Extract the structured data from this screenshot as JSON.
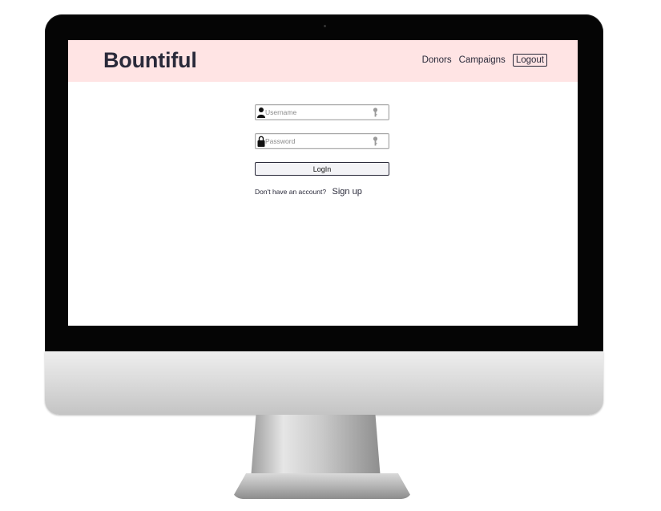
{
  "navbar": {
    "brand": "Bountiful",
    "links": [
      "Donors",
      "Campaigns"
    ],
    "logout_label": "Logout"
  },
  "login": {
    "username_placeholder": "Username",
    "password_placeholder": "Password",
    "button_label": "LogIn",
    "signup_prompt": "Don't have an account?",
    "signup_link": "Sign up"
  },
  "icons": {
    "user": "user-icon",
    "lock": "lock-icon",
    "key": "key-icon"
  },
  "colors": {
    "navbar_bg": "#ffe4e4",
    "text": "#2a2a3a"
  }
}
